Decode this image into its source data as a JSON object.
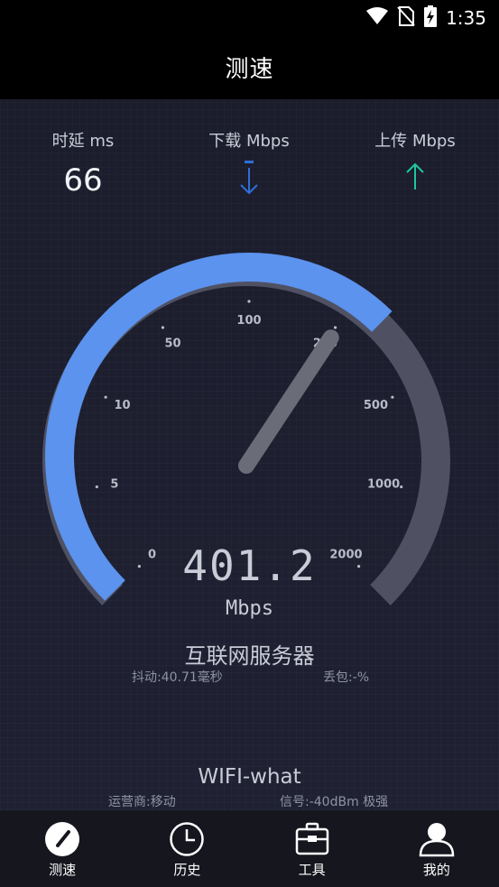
{
  "status_bar": {
    "time": "1:35",
    "icons": [
      "wifi-icon",
      "no-sim-icon",
      "battery-charging-icon"
    ]
  },
  "appbar": {
    "title": "测速"
  },
  "metrics": {
    "latency": {
      "label": "时延 ms",
      "value": "66"
    },
    "download": {
      "label": "下载 Mbps",
      "icon": "download-arrow-icon",
      "color": "#2f6fd8"
    },
    "upload": {
      "label": "上传 Mbps",
      "icon": "upload-arrow-icon",
      "color": "#1ec7a0"
    }
  },
  "gauge": {
    "ticks": [
      "0",
      "5",
      "10",
      "50",
      "100",
      "250",
      "500",
      "1000",
      "2000"
    ],
    "level_fraction": 0.665,
    "active_color": "#5b93ee",
    "track_color": "#4f5163",
    "needle_color": "#6a6c78"
  },
  "speed": {
    "value": "401.2",
    "unit": "Mbps"
  },
  "server": {
    "name": "互联网服务器",
    "jitter": "抖动:40.71毫秒",
    "loss": "丢包:-%"
  },
  "network": {
    "name": "WIFI-what",
    "carrier": "运营商:移动",
    "signal": "信号:-40dBm 极强"
  },
  "nav": {
    "items": [
      {
        "label": "测速",
        "icon": "speedometer-icon"
      },
      {
        "label": "历史",
        "icon": "clock-icon"
      },
      {
        "label": "工具",
        "icon": "toolbox-icon"
      },
      {
        "label": "我的",
        "icon": "user-icon"
      }
    ]
  }
}
